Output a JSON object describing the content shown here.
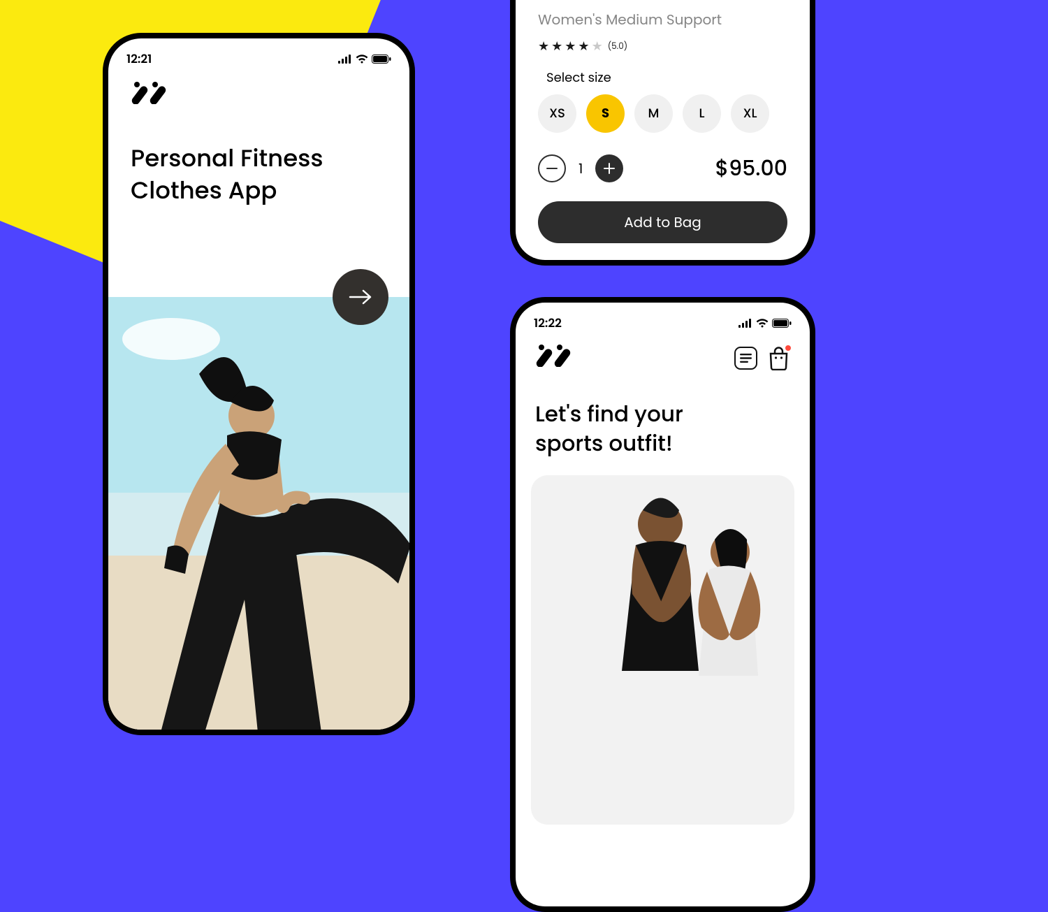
{
  "colors": {
    "accent_yellow": "#f9c500",
    "bg_purple": "#4e44ff",
    "corner_yellow": "#fbea0f",
    "dark": "#2d2d2d",
    "notify_red": "#ff4a3d"
  },
  "left_phone": {
    "time": "12:21",
    "title_line1": "Personal Fitness",
    "title_line2": "Clothes App"
  },
  "product_detail": {
    "subtitle": "Women's Medium Support",
    "rating": {
      "stars_filled": 4,
      "stars_total": 5,
      "score_text": "(5.0)"
    },
    "select_size_label": "Select size",
    "sizes": [
      "XS",
      "S",
      "M",
      "L",
      "XL"
    ],
    "size_selected": "S",
    "quantity": "1",
    "price": "$95.00",
    "add_to_bag_label": "Add to Bag"
  },
  "home_phone": {
    "time": "12:22",
    "title_line1": "Let's find your",
    "title_line2": "sports outfit!"
  }
}
